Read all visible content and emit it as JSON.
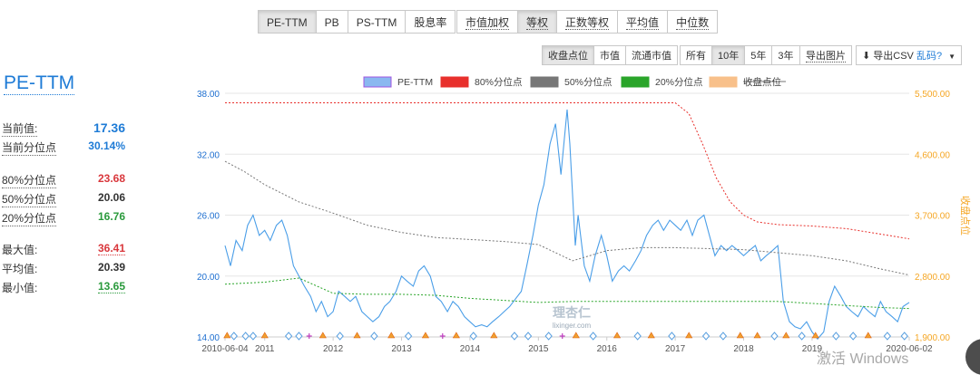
{
  "metric_tabs": [
    {
      "label": "PE-TTM",
      "active": true
    },
    {
      "label": "PB",
      "active": false
    },
    {
      "label": "PS-TTM",
      "active": false
    },
    {
      "label": "股息率",
      "active": false
    }
  ],
  "weight_tabs": [
    {
      "label": "市值加权",
      "active": false
    },
    {
      "label": "等权",
      "active": true
    },
    {
      "label": "正数等权",
      "active": false
    },
    {
      "label": "平均值",
      "active": false
    },
    {
      "label": "中位数",
      "active": false
    }
  ],
  "overlay_tabs": [
    {
      "label": "收盘点位",
      "active": true
    },
    {
      "label": "市值",
      "active": false
    },
    {
      "label": "流通市值",
      "active": false
    }
  ],
  "range_tabs": [
    {
      "label": "所有",
      "active": false
    },
    {
      "label": "10年",
      "active": true
    },
    {
      "label": "5年",
      "active": false
    },
    {
      "label": "3年",
      "active": false
    }
  ],
  "export_image": "导出图片",
  "export_csv": {
    "prefix": "导出CSV",
    "link": "乱码?"
  },
  "side": {
    "title": "PE-TTM",
    "current_value": {
      "label": "当前值:",
      "value": "17.36"
    },
    "current_pct": {
      "label": "当前分位点",
      "value": "30.14%"
    },
    "p80": {
      "label": "80%分位点",
      "value": "23.68"
    },
    "p50": {
      "label": "50%分位点",
      "value": "20.06"
    },
    "p20": {
      "label": "20%分位点",
      "value": "16.76"
    },
    "max": {
      "label": "最大值:",
      "value": "36.41"
    },
    "avg": {
      "label": "平均值:",
      "value": "20.39"
    },
    "min": {
      "label": "最小值:",
      "value": "13.65"
    }
  },
  "chart_data": {
    "type": "line",
    "legend_position": "top",
    "colors": {
      "pe": "#4a9ee8",
      "p80": "#e8302c",
      "p50": "#777777",
      "p20": "#2aa52a",
      "close": "#f5a623",
      "axis_right": "#f5a623"
    },
    "series": [
      {
        "name": "PE-TTM",
        "axis": "left",
        "x": [
          2010.42,
          2010.5,
          2010.58,
          2010.67,
          2010.75,
          2010.83,
          2010.92,
          2011.0,
          2011.08,
          2011.17,
          2011.25,
          2011.33,
          2011.42,
          2011.5,
          2011.58,
          2011.67,
          2011.75,
          2011.83,
          2011.92,
          2012.0,
          2012.08,
          2012.17,
          2012.25,
          2012.33,
          2012.42,
          2012.5,
          2012.58,
          2012.67,
          2012.75,
          2012.83,
          2012.92,
          2013.0,
          2013.08,
          2013.17,
          2013.25,
          2013.33,
          2013.42,
          2013.5,
          2013.58,
          2013.67,
          2013.75,
          2013.83,
          2013.92,
          2014.0,
          2014.08,
          2014.17,
          2014.25,
          2014.33,
          2014.42,
          2014.5,
          2014.58,
          2014.67,
          2014.75,
          2014.83,
          2014.92,
          2015.0,
          2015.08,
          2015.17,
          2015.25,
          2015.33,
          2015.42,
          2015.46,
          2015.5,
          2015.54,
          2015.58,
          2015.67,
          2015.75,
          2015.83,
          2015.92,
          2016.0,
          2016.08,
          2016.17,
          2016.25,
          2016.33,
          2016.42,
          2016.5,
          2016.58,
          2016.67,
          2016.75,
          2016.83,
          2016.92,
          2017.0,
          2017.08,
          2017.17,
          2017.25,
          2017.33,
          2017.42,
          2017.5,
          2017.58,
          2017.67,
          2017.75,
          2017.83,
          2017.92,
          2018.0,
          2018.08,
          2018.17,
          2018.25,
          2018.33,
          2018.42,
          2018.5,
          2018.58,
          2018.67,
          2018.75,
          2018.83,
          2018.92,
          2019.0,
          2019.08,
          2019.17,
          2019.25,
          2019.33,
          2019.42,
          2019.5,
          2019.58,
          2019.67,
          2019.75,
          2019.83,
          2019.92,
          2020.0,
          2020.08,
          2020.17,
          2020.25,
          2020.33,
          2020.42
        ],
        "values": [
          23.0,
          21.0,
          23.5,
          22.5,
          25.0,
          26.0,
          24.0,
          24.5,
          23.5,
          25.0,
          25.5,
          24.0,
          21.0,
          20.0,
          19.0,
          18.0,
          16.5,
          17.5,
          16.0,
          16.5,
          18.5,
          18.0,
          17.5,
          18.0,
          16.5,
          16.0,
          15.5,
          16.0,
          17.0,
          17.5,
          18.5,
          20.0,
          19.5,
          19.0,
          20.5,
          21.0,
          20.0,
          18.0,
          17.5,
          16.5,
          17.5,
          17.0,
          16.0,
          15.5,
          15.0,
          15.2,
          15.0,
          15.5,
          16.0,
          16.5,
          17.0,
          17.8,
          18.5,
          21.0,
          24.0,
          27.0,
          29.0,
          33.0,
          35.0,
          30.0,
          36.4,
          33.0,
          28.0,
          23.0,
          26.0,
          21.0,
          19.5,
          22.0,
          24.0,
          22.0,
          19.5,
          20.5,
          21.0,
          20.5,
          21.5,
          22.5,
          24.0,
          25.0,
          25.5,
          24.5,
          25.5,
          25.0,
          24.5,
          25.5,
          24.0,
          25.5,
          26.0,
          24.0,
          22.0,
          23.0,
          22.5,
          23.0,
          22.5,
          22.0,
          22.5,
          23.0,
          21.5,
          22.0,
          22.5,
          23.0,
          17.5,
          15.5,
          15.0,
          14.8,
          15.5,
          14.5,
          13.8,
          14.5,
          17.5,
          19.0,
          18.0,
          17.0,
          16.5,
          16.0,
          17.0,
          16.5,
          16.0,
          17.5,
          16.5,
          16.0,
          15.5,
          17.0,
          17.4
        ]
      },
      {
        "name": "80%分位点",
        "axis": "right",
        "x": [
          2010.42,
          2017.0,
          2017.2,
          2017.4,
          2017.6,
          2017.8,
          2018.0,
          2018.2,
          2018.5,
          2019.0,
          2019.5,
          2020.0,
          2020.42
        ],
        "values": [
          5360,
          5360,
          5200,
          4750,
          4250,
          3900,
          3700,
          3600,
          3560,
          3540,
          3500,
          3420,
          3350
        ]
      },
      {
        "name": "50%分位点",
        "axis": "left",
        "x": [
          2010.42,
          2010.7,
          2011.0,
          2011.5,
          2012.0,
          2012.5,
          2013.0,
          2013.5,
          2014.0,
          2014.5,
          2015.0,
          2015.5,
          2016.0,
          2016.5,
          2017.0,
          2017.5,
          2018.0,
          2018.5,
          2019.0,
          2019.5,
          2020.0,
          2020.42
        ],
        "values": [
          31.3,
          30.3,
          29.0,
          27.3,
          26.2,
          25.0,
          24.3,
          23.8,
          23.6,
          23.4,
          23.1,
          21.5,
          22.5,
          22.8,
          22.8,
          22.7,
          22.6,
          22.3,
          22.0,
          21.5,
          20.7,
          20.1
        ]
      },
      {
        "name": "20%分位点",
        "axis": "left",
        "x": [
          2010.42,
          2011.0,
          2011.5,
          2012.0,
          2012.5,
          2013.0,
          2013.5,
          2014.0,
          2014.5,
          2015.0,
          2015.5,
          2016.0,
          2016.5,
          2017.0,
          2017.5,
          2018.0,
          2018.5,
          2019.0,
          2019.5,
          2020.0,
          2020.42
        ],
        "values": [
          19.2,
          19.4,
          19.8,
          18.3,
          18.2,
          18.2,
          18.1,
          17.8,
          17.6,
          17.4,
          17.5,
          17.5,
          17.5,
          17.5,
          17.5,
          17.5,
          17.5,
          17.3,
          17.1,
          16.9,
          16.8
        ]
      },
      {
        "name": "收盘点位",
        "axis": "right",
        "hidden": true,
        "x": [],
        "values": []
      }
    ],
    "left_axis": {
      "min": 14,
      "max": 38,
      "ticks": [
        "14.00",
        "20.00",
        "26.00",
        "32.00",
        "38.00"
      ]
    },
    "right_axis": {
      "label": "收盘点位",
      "min": 1900,
      "max": 5500,
      "ticks": [
        "1,900.00",
        "2,800.00",
        "3,700.00",
        "4,600.00",
        "5,500.00"
      ]
    },
    "x_axis": {
      "min": 2010.42,
      "max": 2020.42,
      "ticks": [
        {
          "label": "2010-06-04",
          "x": 2010.42
        },
        {
          "label": "2011",
          "x": 2011.0
        },
        {
          "label": "2012",
          "x": 2012.0
        },
        {
          "label": "2013",
          "x": 2013.0
        },
        {
          "label": "2014",
          "x": 2014.0
        },
        {
          "label": "2015",
          "x": 2015.0
        },
        {
          "label": "2016",
          "x": 2016.0
        },
        {
          "label": "2017",
          "x": 2017.0
        },
        {
          "label": "2018",
          "x": 2018.0
        },
        {
          "label": "2019",
          "x": 2019.0
        },
        {
          "label": "2020-06-02",
          "x": 2020.42
        }
      ]
    },
    "markers": [
      {
        "x": 2010.45,
        "symbol": "triangle"
      },
      {
        "x": 2010.55,
        "symbol": "diamond"
      },
      {
        "x": 2010.72,
        "symbol": "diamond"
      },
      {
        "x": 2010.83,
        "symbol": "diamond"
      },
      {
        "x": 2011.0,
        "symbol": "triangle"
      },
      {
        "x": 2011.35,
        "symbol": "diamond"
      },
      {
        "x": 2011.5,
        "symbol": "diamond"
      },
      {
        "x": 2011.65,
        "symbol": "plus"
      },
      {
        "x": 2011.85,
        "symbol": "triangle"
      },
      {
        "x": 2012.1,
        "symbol": "diamond"
      },
      {
        "x": 2012.35,
        "symbol": "triangle"
      },
      {
        "x": 2012.6,
        "symbol": "diamond"
      },
      {
        "x": 2012.85,
        "symbol": "triangle"
      },
      {
        "x": 2013.1,
        "symbol": "diamond"
      },
      {
        "x": 2013.35,
        "symbol": "triangle"
      },
      {
        "x": 2013.6,
        "symbol": "plus"
      },
      {
        "x": 2013.8,
        "symbol": "triangle"
      },
      {
        "x": 2014.05,
        "symbol": "diamond"
      },
      {
        "x": 2014.35,
        "symbol": "triangle"
      },
      {
        "x": 2014.65,
        "symbol": "diamond"
      },
      {
        "x": 2014.85,
        "symbol": "diamond"
      },
      {
        "x": 2015.15,
        "symbol": "diamond"
      },
      {
        "x": 2015.35,
        "symbol": "plus"
      },
      {
        "x": 2015.55,
        "symbol": "triangle"
      },
      {
        "x": 2015.8,
        "symbol": "diamond"
      },
      {
        "x": 2016.15,
        "symbol": "triangle"
      },
      {
        "x": 2016.45,
        "symbol": "diamond"
      },
      {
        "x": 2016.65,
        "symbol": "triangle"
      },
      {
        "x": 2016.95,
        "symbol": "diamond"
      },
      {
        "x": 2017.2,
        "symbol": "triangle"
      },
      {
        "x": 2017.45,
        "symbol": "diamond"
      },
      {
        "x": 2017.7,
        "symbol": "diamond"
      },
      {
        "x": 2017.95,
        "symbol": "triangle"
      },
      {
        "x": 2018.2,
        "symbol": "triangle"
      },
      {
        "x": 2018.45,
        "symbol": "diamond"
      },
      {
        "x": 2018.62,
        "symbol": "triangle"
      },
      {
        "x": 2018.85,
        "symbol": "diamond"
      },
      {
        "x": 2019.05,
        "symbol": "triangle"
      },
      {
        "x": 2019.35,
        "symbol": "diamond"
      },
      {
        "x": 2019.6,
        "symbol": "diamond"
      },
      {
        "x": 2019.82,
        "symbol": "triangle"
      },
      {
        "x": 2020.1,
        "symbol": "diamond"
      },
      {
        "x": 2020.35,
        "symbol": "diamond"
      }
    ],
    "logo": {
      "title": "理杏仁",
      "subtitle": "lixinger.com"
    }
  },
  "watermark": "激活 Windows"
}
